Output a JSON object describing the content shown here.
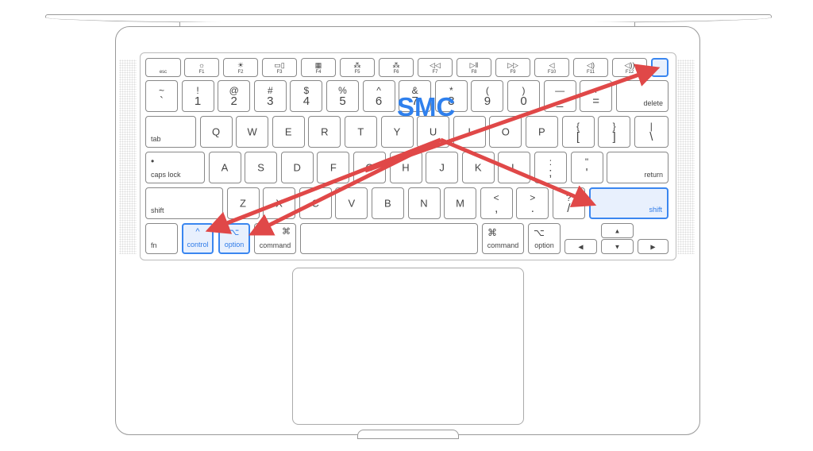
{
  "annotation": {
    "label": "SMC",
    "label_color": "#2f80ed",
    "arrow_color": "#e04848",
    "highlight_color": "#3a86f0"
  },
  "function_row": [
    {
      "b": "esc"
    },
    {
      "t": "☼",
      "b": "F1"
    },
    {
      "t": "☀",
      "b": "F2"
    },
    {
      "t": "▭▯",
      "b": "F3"
    },
    {
      "t": "▦",
      "b": "F4"
    },
    {
      "t": "⁂",
      "b": "F5"
    },
    {
      "t": "⁂",
      "b": "F6"
    },
    {
      "t": "◁◁",
      "b": "F7"
    },
    {
      "t": "▷‖",
      "b": "F8"
    },
    {
      "t": "▷▷",
      "b": "F9"
    },
    {
      "t": "◁",
      "b": "F10"
    },
    {
      "t": "◁)",
      "b": "F11"
    },
    {
      "t": "◁))",
      "b": "F12"
    },
    {
      "b": "",
      "hl": true,
      "name": "power-key"
    }
  ],
  "number_row": [
    {
      "t": "~",
      "b": "`"
    },
    {
      "t": "!",
      "b": "1"
    },
    {
      "t": "@",
      "b": "2"
    },
    {
      "t": "#",
      "b": "3"
    },
    {
      "t": "$",
      "b": "4"
    },
    {
      "t": "%",
      "b": "5"
    },
    {
      "t": "^",
      "b": "6"
    },
    {
      "t": "&",
      "b": "7"
    },
    {
      "t": "*",
      "b": "8"
    },
    {
      "t": "(",
      "b": "9"
    },
    {
      "t": ")",
      "b": "0"
    },
    {
      "t": "—",
      "b": "_"
    },
    {
      "t": "+",
      "b": "="
    },
    {
      "br": "delete"
    }
  ],
  "tab_row": [
    {
      "bl": "tab"
    },
    {
      "c": "Q"
    },
    {
      "c": "W"
    },
    {
      "c": "E"
    },
    {
      "c": "R"
    },
    {
      "c": "T"
    },
    {
      "c": "Y"
    },
    {
      "c": "U"
    },
    {
      "c": "I"
    },
    {
      "c": "O"
    },
    {
      "c": "P"
    },
    {
      "t": "{",
      "b": "["
    },
    {
      "t": "}",
      "b": "]"
    },
    {
      "t": "|",
      "b": "\\"
    }
  ],
  "caps_row": [
    {
      "tl": "•",
      "bl": "caps lock"
    },
    {
      "c": "A"
    },
    {
      "c": "S"
    },
    {
      "c": "D"
    },
    {
      "c": "F"
    },
    {
      "c": "G"
    },
    {
      "c": "H"
    },
    {
      "c": "J"
    },
    {
      "c": "K"
    },
    {
      "c": "L"
    },
    {
      "t": ":",
      "b": ";"
    },
    {
      "t": "\"",
      "b": "'"
    },
    {
      "br": "return"
    }
  ],
  "shift_row": [
    {
      "bl": "shift"
    },
    {
      "c": "Z"
    },
    {
      "c": "X"
    },
    {
      "c": "C"
    },
    {
      "c": "V"
    },
    {
      "c": "B"
    },
    {
      "c": "N"
    },
    {
      "c": "M"
    },
    {
      "t": "<",
      "b": ","
    },
    {
      "t": ">",
      "b": "."
    },
    {
      "t": "?",
      "b": "/"
    },
    {
      "br": "shift",
      "hl": true,
      "name": "right-shift-key"
    }
  ],
  "bottom_row": [
    {
      "bl": "fn"
    },
    {
      "tc": "^",
      "bc": "control",
      "hl": true,
      "name": "left-control-key"
    },
    {
      "tc": "⌥",
      "bc": "option",
      "hl": true,
      "name": "left-option-key"
    },
    {
      "tr": "⌘",
      "bc": "command"
    },
    {},
    {
      "tl": "⌘",
      "bc": "command"
    },
    {
      "tl": "⌥",
      "bc": "option"
    },
    {
      "c": "◀",
      "ar": true
    },
    {
      "c": "▲",
      "ar": true
    },
    {
      "c": "▼",
      "ar": true
    },
    {
      "c": "▶",
      "ar": true
    }
  ]
}
